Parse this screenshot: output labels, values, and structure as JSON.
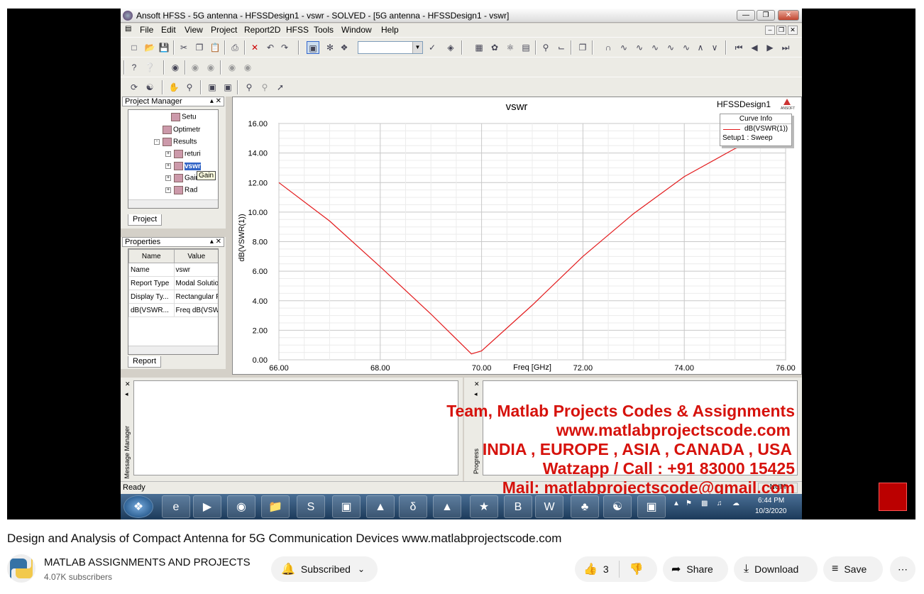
{
  "window": {
    "title": "Ansoft HFSS  - 5G antenna - HFSSDesign1 - vswr - SOLVED - [5G antenna - HFSSDesign1 - vswr]",
    "menu": [
      "File",
      "Edit",
      "View",
      "Project",
      "Report2D",
      "HFSS",
      "Tools",
      "Window",
      "Help"
    ]
  },
  "project_manager": {
    "header": "Project Manager",
    "tab": "Project",
    "tree": [
      {
        "label": "Setu",
        "indent": 3
      },
      {
        "label": "Optimetr",
        "indent": 2
      },
      {
        "label": "Results",
        "indent": 2
      },
      {
        "label": "returi",
        "indent": 3
      },
      {
        "label": "vswr",
        "indent": 3,
        "selected": true
      },
      {
        "label": "Gain",
        "indent": 3
      },
      {
        "label": "Rad",
        "indent": 3
      }
    ],
    "tooltip": "Gain"
  },
  "properties": {
    "header": "Properties",
    "tab": "Report",
    "columns": [
      "Name",
      "Value"
    ],
    "rows": [
      [
        "Name",
        "vswr"
      ],
      [
        "Report Type",
        "Modal Solution"
      ],
      [
        "Display Ty...",
        "Rectangular P"
      ],
      [
        "dB(VSWR...",
        "Freq dB(VSW"
      ]
    ]
  },
  "plot": {
    "design_label": "HFSSDesign1",
    "brand": "ANSOFT",
    "curve_info_title": "Curve Info",
    "curve_name": "dB(VSWR(1))",
    "curve_setup": "Setup1 : Sweep"
  },
  "chart_data": {
    "type": "line",
    "title": "vswr",
    "xlabel": "Freq [GHz]",
    "ylabel": "dB(VSWR(1))",
    "xlim": [
      66,
      76
    ],
    "ylim": [
      0,
      16
    ],
    "xticks": [
      "66.00",
      "68.00",
      "70.00",
      "72.00",
      "74.00",
      "76.00"
    ],
    "yticks": [
      "0.00",
      "2.00",
      "4.00",
      "6.00",
      "8.00",
      "10.00",
      "12.00",
      "14.00",
      "16.00"
    ],
    "grid": true,
    "line_color": "#e31a1c",
    "series": [
      {
        "name": "dB(VSWR(1))",
        "x": [
          66,
          67,
          68,
          69,
          69.8,
          70,
          71,
          72,
          73,
          74,
          75,
          76
        ],
        "y": [
          12.0,
          9.4,
          6.3,
          3.1,
          0.4,
          0.6,
          3.7,
          7.0,
          9.9,
          12.4,
          14.3,
          15.6
        ]
      }
    ]
  },
  "panes": {
    "message_manager": "Message Manager",
    "progress": "Progress"
  },
  "status": "Ready",
  "watermark": {
    "line1": "Team, Matlab Projects Codes & Assignments",
    "line2": "www.matlabprojectscode.com",
    "line3": "INDIA , EUROPE , ASIA , CANADA , USA",
    "line4": "Watzapp / Call : +91 83000 15425",
    "line5": "Mail: matlabprojectscode@gmail.com"
  },
  "taskbar": {
    "time": "6:44 PM",
    "date": "10/3/2020"
  },
  "video": {
    "title": "Design and Analysis of Compact Antenna for 5G Communication Devices www.matlabprojectscode.com",
    "channel": "MATLAB ASSIGNMENTS AND PROJECTS",
    "subscribers": "4.07K subscribers",
    "subscribed_label": "Subscribed",
    "likes": "3",
    "share_label": "Share",
    "download_label": "Download",
    "save_label": "Save"
  }
}
